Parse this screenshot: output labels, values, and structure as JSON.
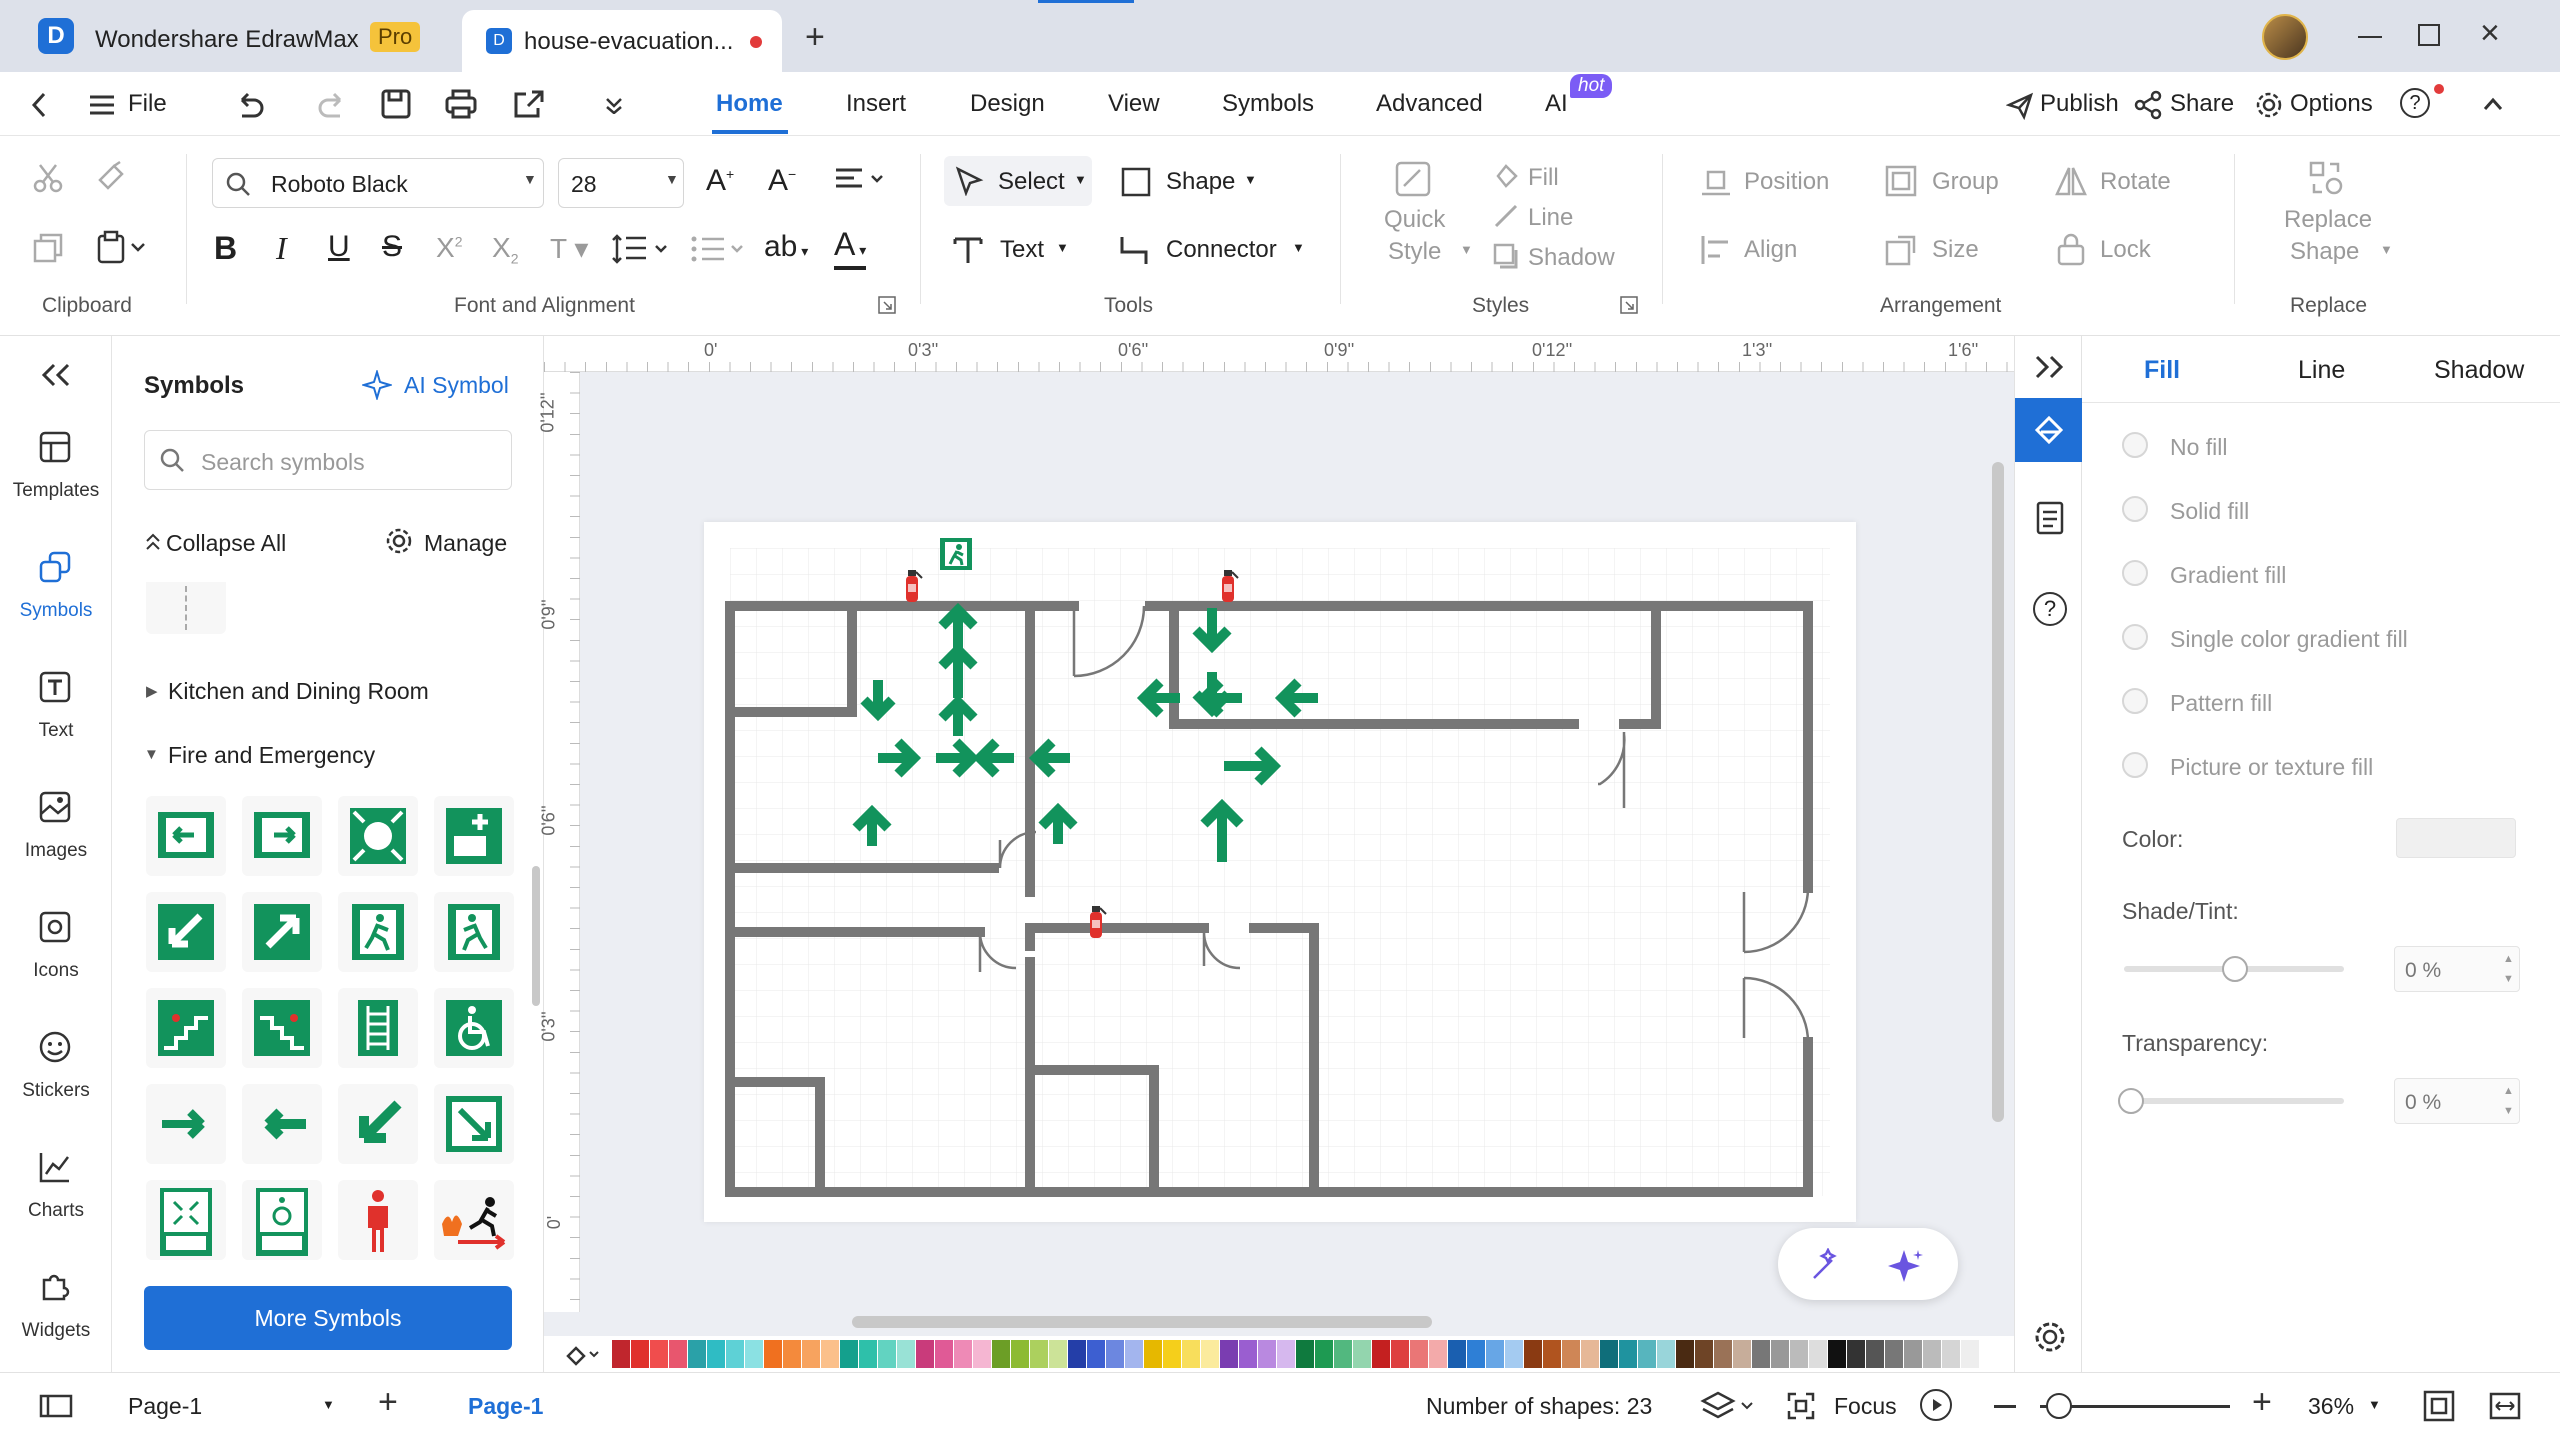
{
  "titlebar": {
    "app_name": "Wondershare EdrawMax",
    "pro_badge": "Pro",
    "doc_tab": "house-evacuation...",
    "add_tab": "+"
  },
  "menu": {
    "file": "File",
    "tabs": [
      "Home",
      "Insert",
      "Design",
      "View",
      "Symbols",
      "Advanced",
      "AI"
    ],
    "ai_badge": "hot",
    "publish": "Publish",
    "share": "Share",
    "options": "Options"
  },
  "ribbon": {
    "font_name": "Roboto Black",
    "font_size": "28",
    "select": "Select",
    "shape": "Shape",
    "text": "Text",
    "connector": "Connector",
    "quick_style_1": "Quick",
    "quick_style_2": "Style",
    "fill": "Fill",
    "line": "Line",
    "shadow": "Shadow",
    "position": "Position",
    "group": "Group",
    "rotate": "Rotate",
    "align": "Align",
    "size": "Size",
    "lock": "Lock",
    "replace_1": "Replace",
    "replace_2": "Shape",
    "groups": {
      "clipboard": "Clipboard",
      "font": "Font and Alignment",
      "tools": "Tools",
      "styles": "Styles",
      "arrangement": "Arrangement",
      "replace": "Replace"
    }
  },
  "sidebar": {
    "items": [
      "Templates",
      "Symbols",
      "Text",
      "Images",
      "Icons",
      "Stickers",
      "Charts",
      "Widgets"
    ]
  },
  "library": {
    "title": "Symbols",
    "ai_symbol": "AI Symbol",
    "search_placeholder": "Search symbols",
    "collapse_all": "Collapse All",
    "manage": "Manage",
    "category_1": "Kitchen and Dining Room",
    "category_2": "Fire and Emergency",
    "more_symbols": "More Symbols"
  },
  "ruler": {
    "top": [
      "0'",
      "0'3''",
      "0'6''",
      "0'9''",
      "0'12''",
      "1'3''",
      "1'6''"
    ],
    "left": [
      "0'12''",
      "0'9''",
      "0'6''",
      "0'3''",
      "0'"
    ]
  },
  "props": {
    "tabs": [
      "Fill",
      "Line",
      "Shadow"
    ],
    "fill_options": [
      "No fill",
      "Solid fill",
      "Gradient fill",
      "Single color gradient fill",
      "Pattern fill",
      "Picture or texture fill"
    ],
    "color_label": "Color:",
    "shade_label": "Shade/Tint:",
    "shade_value": "0 %",
    "transparency_label": "Transparency:",
    "transparency_value": "0 %"
  },
  "status": {
    "page_select": "Page-1",
    "page_tab": "Page-1",
    "shape_count": "Number of shapes: 23",
    "focus": "Focus",
    "zoom": "36%"
  },
  "colors": {
    "accent": "#1f6fd6",
    "wall": "#777777",
    "arrow_green": "#12935c",
    "extinguisher_red": "#e0312c"
  },
  "palette": [
    "#c0262d",
    "#e0312c",
    "#f04d4d",
    "#e8566e",
    "#2aa1a8",
    "#2fbcc4",
    "#5ed1d6",
    "#8be1e3",
    "#f0701f",
    "#f48a3c",
    "#f7a35f",
    "#fbc08a",
    "#14a08d",
    "#2ec0aa",
    "#62d3c1",
    "#99e2d6",
    "#c93b7b",
    "#e05a96",
    "#ee8ab6",
    "#f5b6d2",
    "#6c9e26",
    "#8dbb33",
    "#acd05e",
    "#cce398",
    "#243ea8",
    "#3d5fd1",
    "#6c87e0",
    "#a3b5ee",
    "#e6b800",
    "#f5cf1b",
    "#f8de5c",
    "#fbeb9d",
    "#7a3db1",
    "#9a5ed0",
    "#b989e0",
    "#d6b8ee",
    "#0f7a3e",
    "#1e9a52",
    "#52b87f",
    "#93d5ae",
    "#c42020",
    "#de4040",
    "#ea7676",
    "#f3aaaa",
    "#1a5fb0",
    "#2e7fd6",
    "#67a6e6",
    "#a4cbf1",
    "#8a3a12",
    "#b0541f",
    "#cf8656",
    "#e6b897",
    "#0f6e7a",
    "#1f939f",
    "#57b5be",
    "#99d5da",
    "#4a2a12",
    "#6e4426",
    "#9a7257",
    "#c7ad9a",
    "#777777",
    "#999999",
    "#bbbbbb",
    "#dddddd",
    "#111111",
    "#333333",
    "#555555",
    "#777777",
    "#999999",
    "#bbbbbb",
    "#d5d5d5",
    "#eeeeee"
  ]
}
